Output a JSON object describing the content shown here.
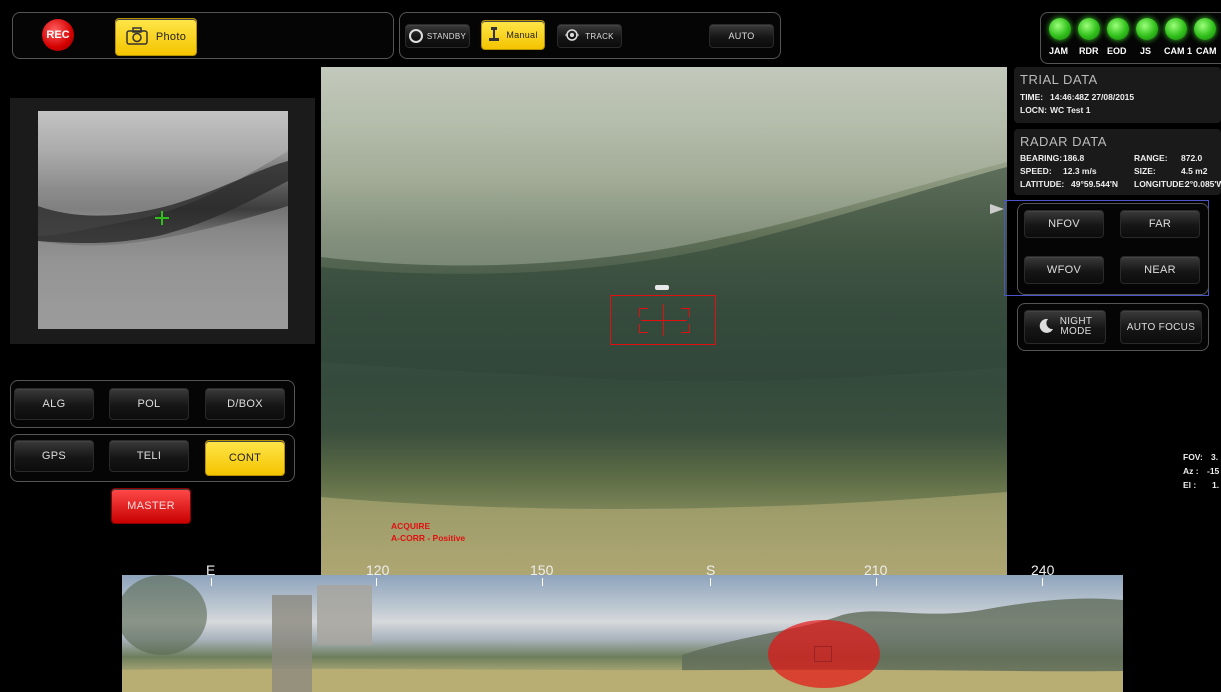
{
  "toolbar": {
    "rec_label": "REC",
    "photo_label": "Photo",
    "standby_label": "STANDBY",
    "manual_label": "Manual",
    "track_label": "TRACK",
    "auto_label": "AUTO"
  },
  "status_leds": [
    "JAM",
    "RDR",
    "EOD",
    "JS",
    "CAM 1",
    "CAM"
  ],
  "trial_data": {
    "title": "TRIAL DATA",
    "time_label": "TIME:",
    "time_value": "14:46:48Z 27/08/2015",
    "locn_label": "LOCN:",
    "locn_value": "WC Test 1"
  },
  "radar_data": {
    "title": "RADAR DATA",
    "bearing_label": "BEARING:",
    "bearing_value": "186.8",
    "range_label": "RANGE:",
    "range_value": "872.0",
    "speed_label": "SPEED:",
    "speed_value": "12.3 m/s",
    "size_label": "SIZE:",
    "size_value": "4.5 m2",
    "latitude_label": "LATITUDE:",
    "latitude_value": "49°59.544'N",
    "longitude_label": "LONGITUDE:",
    "longitude_value": "2°0.085'W"
  },
  "camera_controls": {
    "nfov": "NFOV",
    "far": "FAR",
    "wfov": "WFOV",
    "near": "NEAR",
    "night_mode_1": "NIGHT",
    "night_mode_2": "MODE",
    "auto_focus": "AUTO FOCUS"
  },
  "left_controls": {
    "alg": "ALG",
    "pol": "POL",
    "dbox": "D/BOX",
    "gps": "GPS",
    "teli": "TELI",
    "cont": "CONT",
    "master": "MASTER"
  },
  "overlay": {
    "acquire": "ACQUIRE",
    "acorr": "A-CORR - Positive"
  },
  "fov_readout": {
    "fov_label": "FOV:",
    "fov_value": "3.",
    "az_label": "Az :",
    "az_value": "-15",
    "el_label": "El :",
    "el_value": "1."
  },
  "compass": {
    "ticks": [
      "E",
      "120",
      "150",
      "S",
      "210",
      "240"
    ]
  },
  "colors": {
    "accent_yellow": "#f4c400",
    "rec_red": "#d40000",
    "overlay_red": "#e01010",
    "led_green": "#2fbf1a"
  }
}
